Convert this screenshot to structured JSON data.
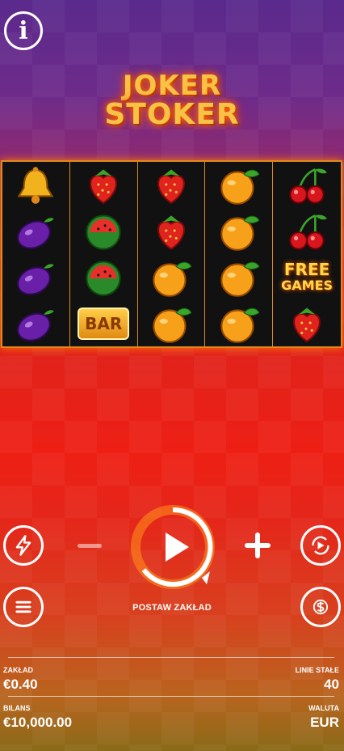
{
  "logo": {
    "line1": "JOKER",
    "line2": "STOKER"
  },
  "reels": [
    [
      "bell",
      "plum",
      "plum",
      "plum"
    ],
    [
      "strawberry",
      "watermelon",
      "watermelon",
      "bar"
    ],
    [
      "strawberry",
      "strawberry",
      "orange",
      "orange"
    ],
    [
      "orange",
      "orange",
      "orange",
      "orange"
    ],
    [
      "cherry",
      "cherry",
      "free-games",
      "strawberry"
    ]
  ],
  "symbols": {
    "bar_label": "BAR",
    "free_line1": "FREE",
    "free_line2": "GAMES"
  },
  "controls": {
    "spin_label": "POSTAW ZAKŁAD",
    "icons": [
      "info-icon",
      "lightning-icon",
      "minus-icon",
      "play-icon",
      "plus-icon",
      "autoplay-icon",
      "menu-icon",
      "coin-dollar-icon"
    ]
  },
  "footer": {
    "bet_label": "ZAKŁAD",
    "bet_value": "€0.40",
    "lines_label": "LINIE STAŁE",
    "lines_value": "40",
    "balance_label": "BILANS",
    "balance_value": "€10,000.00",
    "currency_label": "WALUTA",
    "currency_value": "EUR"
  },
  "colors": {
    "frame": "#e08a1c",
    "accent": "#ff7a00",
    "bg_top": "#5a2a8c",
    "bg_mid": "#ee1f14"
  }
}
